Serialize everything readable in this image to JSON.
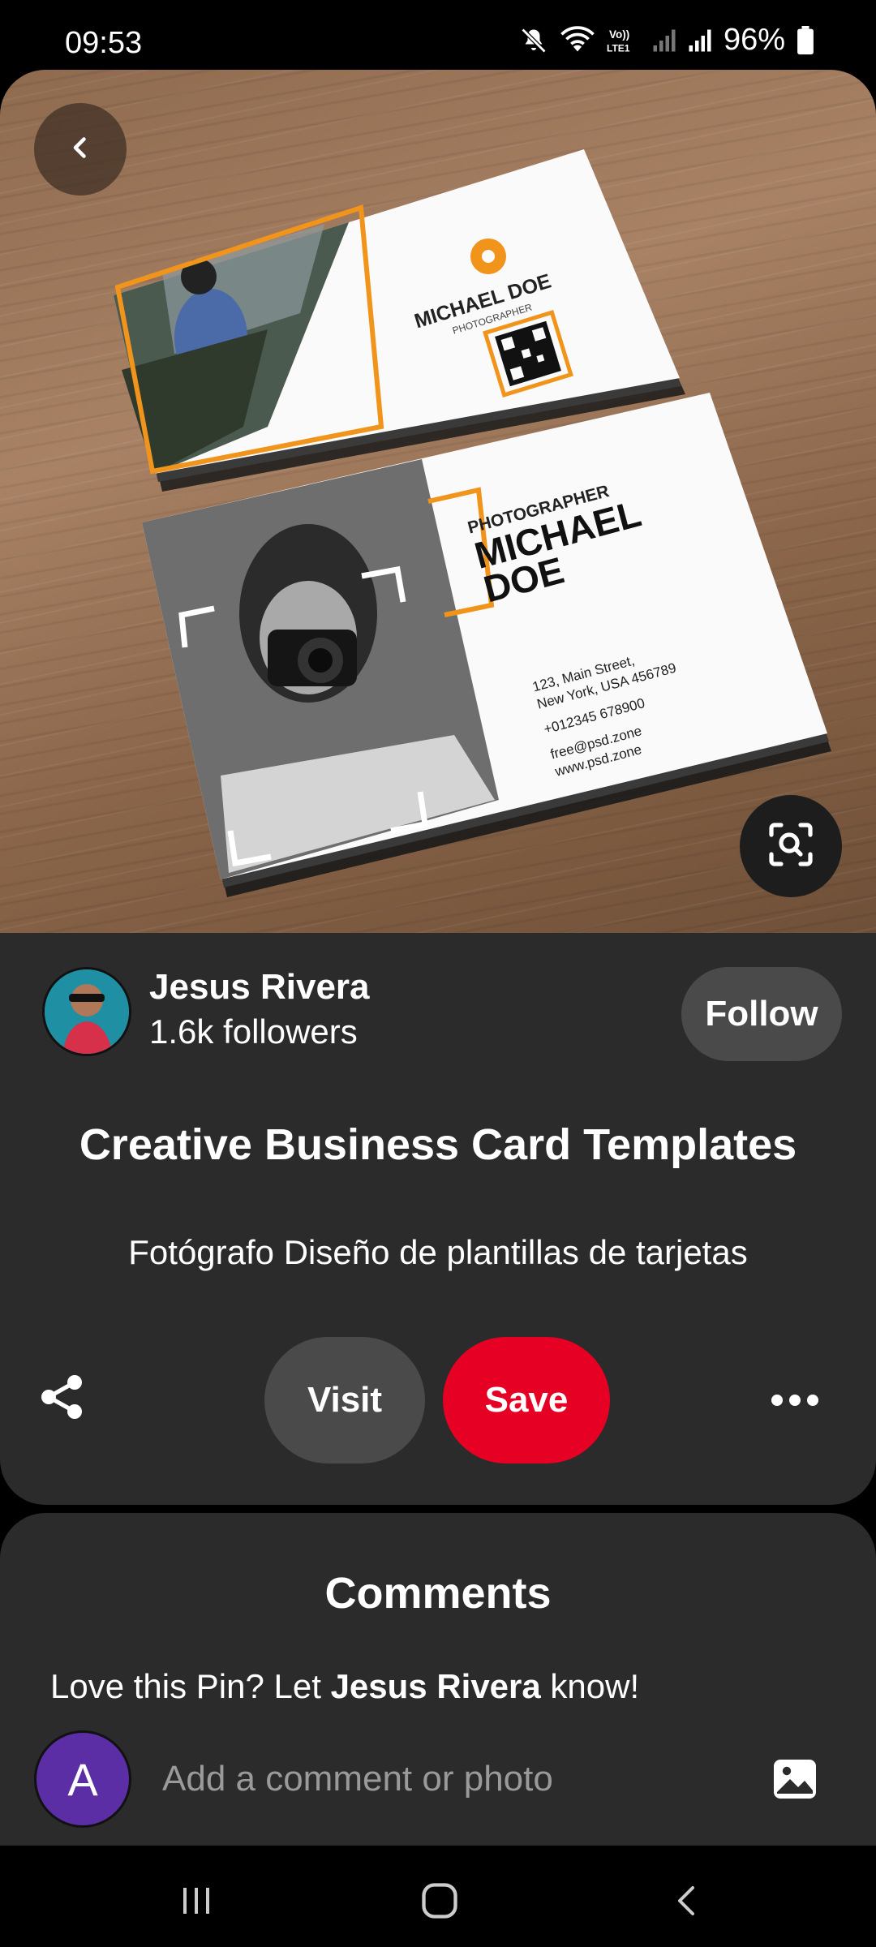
{
  "status_bar": {
    "time": "09:53",
    "battery": "96%",
    "icons": [
      "mute-icon",
      "wifi-icon",
      "volte-icon",
      "signal-icon",
      "signal-icon",
      "battery-icon"
    ]
  },
  "pin": {
    "image_icons": [
      "back-icon",
      "visual-search-icon"
    ],
    "card_front": {
      "name": "MICHAEL DOE",
      "role": "PHOTOGRAPHER"
    },
    "card_back": {
      "role": "PHOTOGRAPHER",
      "name_line1": "MICHAEL",
      "name_line2": "DOE",
      "address_line1": "123, Main Street,",
      "address_line2": "New York, USA 456789",
      "phone": "+012345 678900",
      "email": "free@psd.zone",
      "website": "www.psd.zone"
    }
  },
  "creator": {
    "name": "Jesus Rivera",
    "followers": "1.6k followers",
    "follow_label": "Follow"
  },
  "details": {
    "title": "Creative Business Card Templates",
    "description": "Fotógrafo Diseño de plantillas de tarjetas"
  },
  "actions": {
    "visit_label": "Visit",
    "save_label": "Save",
    "save_color": "#e60023",
    "icons": [
      "share-icon",
      "more-icon"
    ]
  },
  "comments": {
    "title": "Comments",
    "prompt_prefix": "Love this Pin? Let ",
    "prompt_name": "Jesus Rivera",
    "prompt_suffix": " know!",
    "user_initial": "A",
    "user_avatar_color": "#5b2ea6",
    "placeholder": "Add a comment or photo"
  },
  "nav": {
    "icons": [
      "recents-icon",
      "home-icon",
      "back-nav-icon"
    ]
  }
}
